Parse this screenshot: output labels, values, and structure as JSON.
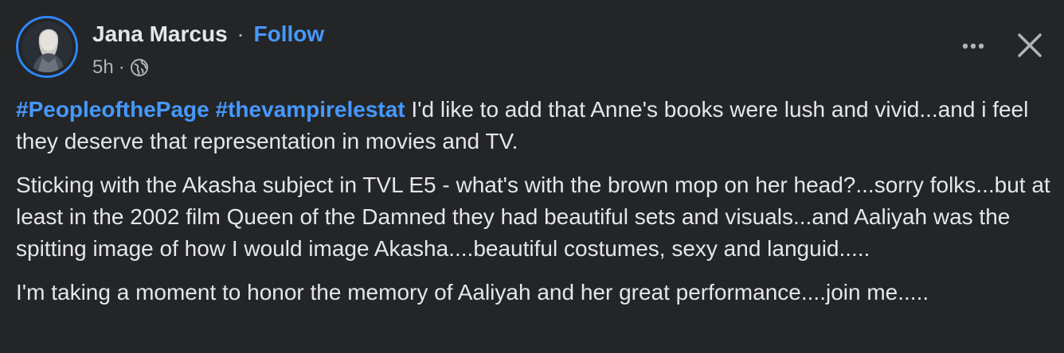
{
  "post": {
    "author": {
      "name": "Jana Marcus",
      "separator": "·",
      "follow_label": "Follow"
    },
    "meta": {
      "time": "5h",
      "separator": "·",
      "audience_icon": "globe-icon"
    },
    "actions": {
      "more_icon": "more-horizontal-icon",
      "close_icon": "close-icon"
    },
    "paragraphs": [
      {
        "hashtags": [
          "#PeopleofthePage",
          "#thevampirelestat"
        ],
        "text": " I'd like to add that Anne's books were lush and vivid...and i feel they deserve that representation  in movies and TV."
      },
      {
        "text": "Sticking with the Akasha subject in TVL E5 - what's with the brown mop on her head?...sorry folks...but at least in the 2002 film Queen of the Damned they had beautiful sets and visuals...and Aaliyah was the spitting image of how I would image Akasha....beautiful costumes, sexy and languid....."
      },
      {
        "text": "I'm taking a moment to honor the memory of Aaliyah and her great performance....join me....."
      }
    ]
  },
  "colors": {
    "background": "#242526",
    "text": "#e4e6eb",
    "secondary_text": "#b0b3b8",
    "link": "#4599ff",
    "avatar_ring": "#2d88ff"
  }
}
